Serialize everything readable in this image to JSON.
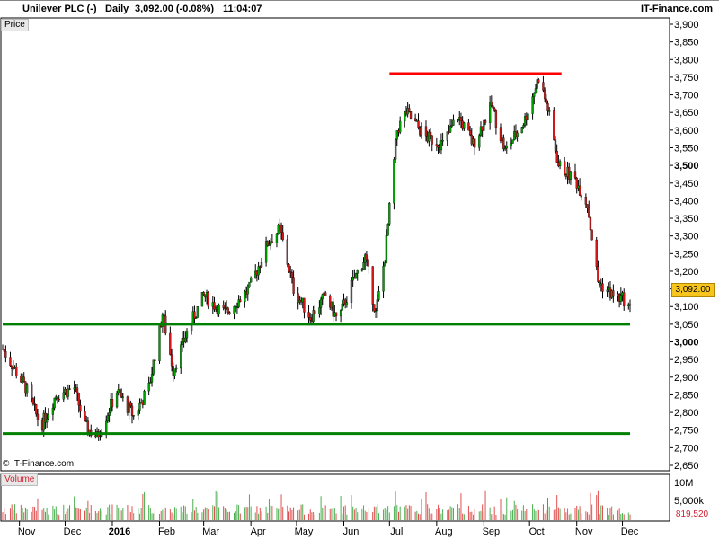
{
  "header": {
    "symbol": "Unilever PLC (-)",
    "interval": "Daily",
    "quote": "3,092.00 (-0.08%)",
    "time": "11:04:07",
    "brand": "IT-Finance.com"
  },
  "price_panel_label": "Price",
  "volume_panel_label": "Volume",
  "watermark": "© IT-Finance.com",
  "last_price_badge": "3,092.00",
  "last_volume_badge": "819,520",
  "colors": {
    "up_candle": "#00a000",
    "down_candle": "#d01818",
    "resistance_line": "#ff0000",
    "support_line": "#008000",
    "price_badge_bg": "#f7c51e",
    "volume_up": "#4caf50",
    "volume_down": "#e05050"
  },
  "chart_data": {
    "type": "candlestick",
    "title": "Unilever PLC (-) Daily",
    "y_axis": {
      "ylim": [
        2650,
        3900
      ],
      "tick_labels": [
        "3,900",
        "3,850",
        "3,800",
        "3,750",
        "3,700",
        "3,650",
        "3,600",
        "3,550",
        "3,500",
        "3,450",
        "3,400",
        "3,350",
        "3,300",
        "3,250",
        "3,200",
        "3,150",
        "3,100",
        "3,050",
        "3,000",
        "2,950",
        "2,900",
        "2,850",
        "2,800",
        "2,750",
        "2,700",
        "2,650"
      ],
      "bold_labels": [
        "3,500",
        "3,000"
      ]
    },
    "x_axis": {
      "range": [
        "2015-10-21",
        "2016-12-06"
      ],
      "tick_labels": [
        "Nov",
        "Dec",
        "2016",
        "Feb",
        "Mar",
        "Apr",
        "May",
        "Jun",
        "Jul",
        "Aug",
        "Sep",
        "Oct",
        "Nov",
        "Dec"
      ],
      "bold_labels": [
        "2016"
      ]
    },
    "volume_axis": {
      "tick_labels": [
        "10M",
        "5,000k"
      ]
    },
    "trend_path": [
      [
        "2015-10-21",
        2980
      ],
      [
        "2015-11-05",
        2870
      ],
      [
        "2015-11-15",
        2760
      ],
      [
        "2015-11-25",
        2850
      ],
      [
        "2015-12-07",
        2870
      ],
      [
        "2015-12-14",
        2760
      ],
      [
        "2015-12-22",
        2730
      ],
      [
        "2016-01-04",
        2860
      ],
      [
        "2016-01-15",
        2790
      ],
      [
        "2016-01-25",
        2870
      ],
      [
        "2016-02-03",
        3080
      ],
      [
        "2016-02-10",
        2920
      ],
      [
        "2016-02-20",
        3040
      ],
      [
        "2016-03-01",
        3130
      ],
      [
        "2016-03-15",
        3080
      ],
      [
        "2016-03-31",
        3150
      ],
      [
        "2016-04-12",
        3280
      ],
      [
        "2016-04-20",
        3320
      ],
      [
        "2016-04-29",
        3150
      ],
      [
        "2016-05-10",
        3070
      ],
      [
        "2016-05-20",
        3130
      ],
      [
        "2016-05-28",
        3060
      ],
      [
        "2016-06-07",
        3170
      ],
      [
        "2016-06-15",
        3240
      ],
      [
        "2016-06-22",
        3080
      ],
      [
        "2016-06-28",
        3240
      ],
      [
        "2016-07-06",
        3600
      ],
      [
        "2016-07-12",
        3650
      ],
      [
        "2016-07-25",
        3580
      ],
      [
        "2016-08-05",
        3560
      ],
      [
        "2016-08-15",
        3640
      ],
      [
        "2016-08-25",
        3560
      ],
      [
        "2016-09-06",
        3670
      ],
      [
        "2016-09-15",
        3540
      ],
      [
        "2016-09-28",
        3630
      ],
      [
        "2016-10-07",
        3750
      ],
      [
        "2016-10-13",
        3660
      ],
      [
        "2016-10-20",
        3500
      ],
      [
        "2016-10-31",
        3460
      ],
      [
        "2016-11-08",
        3390
      ],
      [
        "2016-11-15",
        3170
      ],
      [
        "2016-11-25",
        3130
      ],
      [
        "2016-12-02",
        3120
      ],
      [
        "2016-12-06",
        3092
      ]
    ],
    "horizontal_lines": [
      {
        "name": "resistance",
        "value": 3760,
        "from": "2016-07-01",
        "to": "2016-10-22",
        "color": "#ff0000"
      },
      {
        "name": "support",
        "value": 3050,
        "from": "2015-10-21",
        "to": "2016-12-06",
        "color": "#008000"
      },
      {
        "name": "support",
        "value": 2740,
        "from": "2015-10-21",
        "to": "2016-12-06",
        "color": "#008000"
      }
    ],
    "last_close": 3092,
    "last_volume": 819520,
    "grid": true
  }
}
